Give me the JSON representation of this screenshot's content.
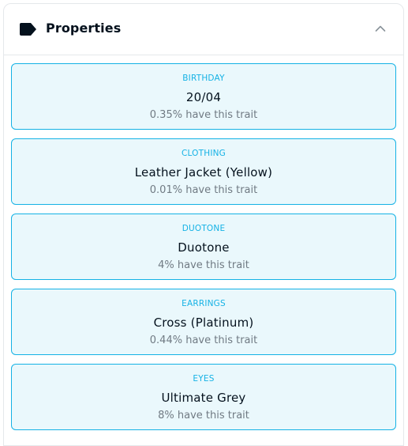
{
  "colors": {
    "accent": "#15b2e5",
    "card_background": "#eaf8fc",
    "text_primary": "#04111d",
    "text_secondary": "#707a83",
    "border": "#e5e8eb"
  },
  "panel": {
    "title": "Properties",
    "title_icon": "tag-icon",
    "toggle_icon": "chevron-up-icon"
  },
  "properties": [
    {
      "trait_type": "BIRTHDAY",
      "value": "20/04",
      "rarity": "0.35% have this trait"
    },
    {
      "trait_type": "CLOTHING",
      "value": "Leather Jacket (Yellow)",
      "rarity": "0.01% have this trait"
    },
    {
      "trait_type": "DUOTONE",
      "value": "Duotone",
      "rarity": "4% have this trait"
    },
    {
      "trait_type": "EARRINGS",
      "value": "Cross (Platinum)",
      "rarity": "0.44% have this trait"
    },
    {
      "trait_type": "EYES",
      "value": "Ultimate Grey",
      "rarity": "8% have this trait"
    }
  ]
}
